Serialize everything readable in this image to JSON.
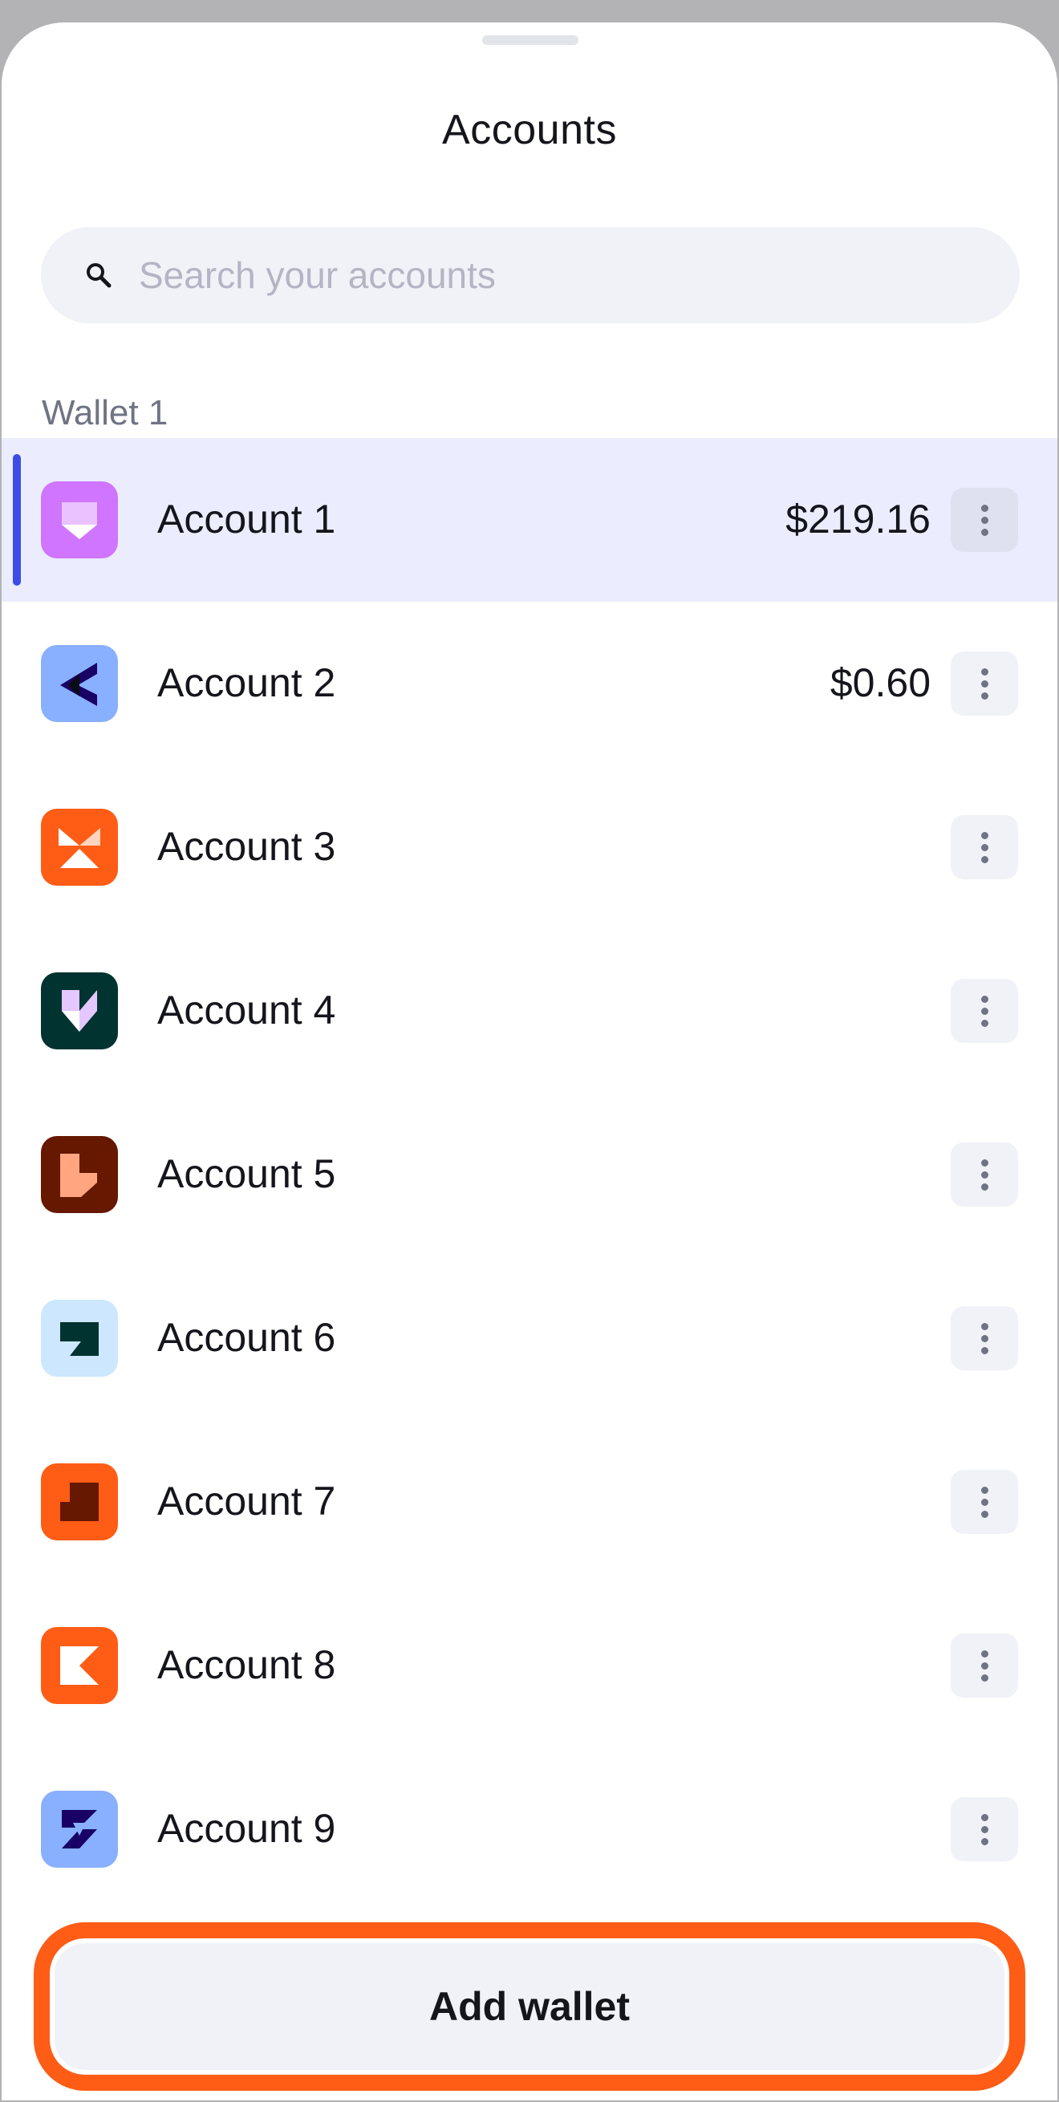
{
  "sheet": {
    "title": "Accounts"
  },
  "search": {
    "placeholder": "Search your accounts",
    "value": ""
  },
  "section": {
    "label": "Wallet 1"
  },
  "accounts": [
    {
      "name": "Account 1",
      "balance": "$219.16",
      "selected": true,
      "icon": "purple-fox-avatar-icon"
    },
    {
      "name": "Account 2",
      "balance": "$0.60",
      "selected": false,
      "icon": "blue-arrow-avatar-icon"
    },
    {
      "name": "Account 3",
      "balance": "",
      "selected": false,
      "icon": "orange-triangles-avatar-icon"
    },
    {
      "name": "Account 4",
      "balance": "",
      "selected": false,
      "icon": "teal-diamond-avatar-icon"
    },
    {
      "name": "Account 5",
      "balance": "",
      "selected": false,
      "icon": "brown-shield-avatar-icon"
    },
    {
      "name": "Account 6",
      "balance": "",
      "selected": false,
      "icon": "lightblue-flag-avatar-icon"
    },
    {
      "name": "Account 7",
      "balance": "",
      "selected": false,
      "icon": "orange-square-avatar-icon"
    },
    {
      "name": "Account 8",
      "balance": "",
      "selected": false,
      "icon": "orange-bowtie-avatar-icon"
    },
    {
      "name": "Account 9",
      "balance": "",
      "selected": false,
      "icon": "blue-bolt-avatar-icon"
    }
  ],
  "footer": {
    "add_wallet_label": "Add wallet"
  },
  "colors": {
    "accent": "#3d4ce6",
    "highlight_border": "#ff5c16",
    "selected_row": "#ebecfd"
  }
}
